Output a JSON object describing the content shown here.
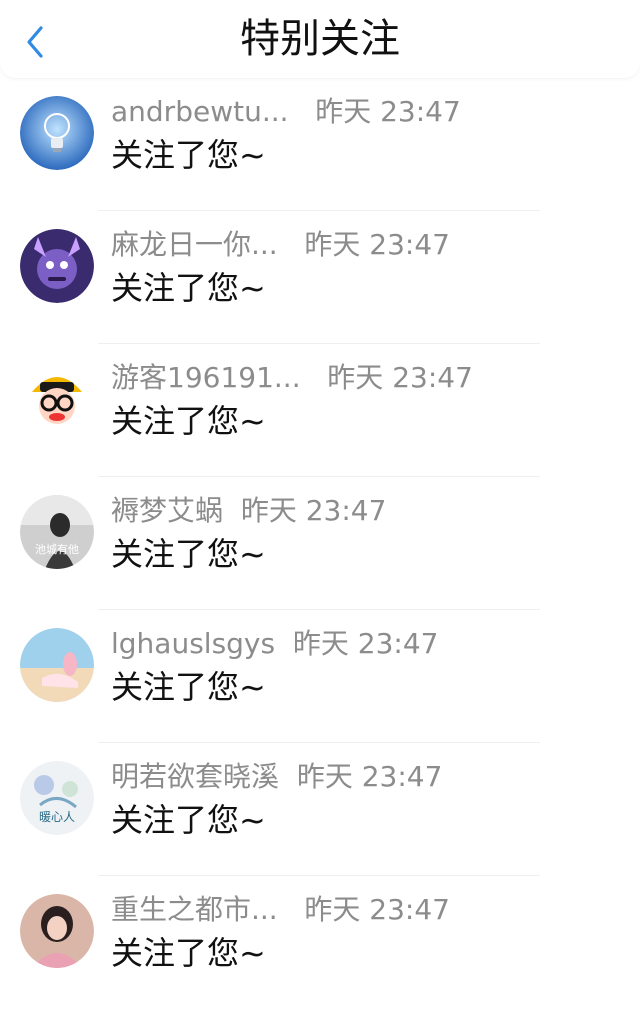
{
  "header": {
    "title": "特别关注",
    "back_icon": "chevron-left-icon",
    "accent": "#2f8ae5"
  },
  "notifications": [
    {
      "name": "andrbewtu...",
      "time": "昨天 23:47",
      "message": "关注了您~",
      "avatar": "lightbulb"
    },
    {
      "name": "麻龙日一你...",
      "time": "昨天 23:47",
      "message": "关注了您~",
      "avatar": "purple-character"
    },
    {
      "name": "游客196191...",
      "time": "昨天 23:47",
      "message": "关注了您~",
      "avatar": "cartoon-glasses"
    },
    {
      "name": "褥梦艾蜗",
      "time": "昨天 23:47",
      "message": "关注了您~",
      "avatar": "grayscale-photo",
      "avatar_text": "池城有他"
    },
    {
      "name": "lghauslsgys",
      "time": "昨天 23:47",
      "message": "关注了您~",
      "avatar": "beach-photo"
    },
    {
      "name": "明若欲套晓溪",
      "time": "昨天 23:47",
      "message": "关注了您~",
      "avatar": "watercolor",
      "avatar_text": "暖心人"
    },
    {
      "name": "重生之都市...",
      "time": "昨天 23:47",
      "message": "关注了您~",
      "avatar": "girl-photo"
    }
  ]
}
